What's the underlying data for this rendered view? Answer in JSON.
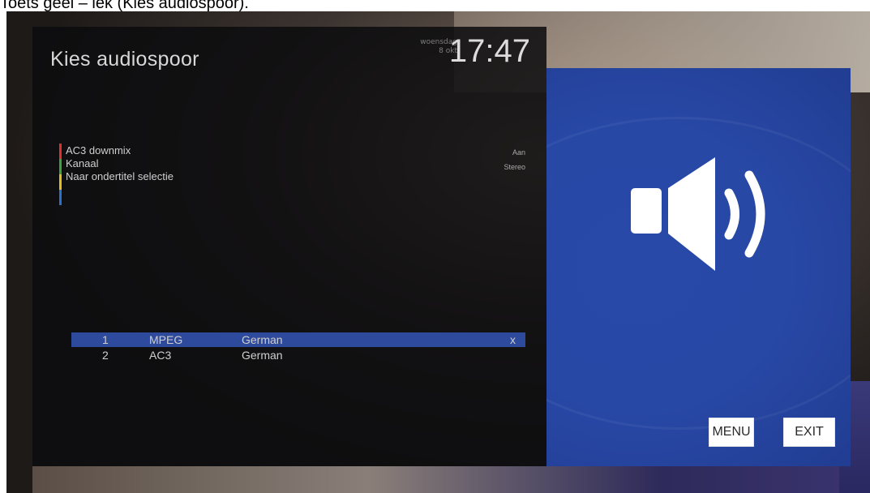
{
  "caption": "Toets geel – lek (Kies audiospoor).",
  "osd": {
    "title": "Kies audiospoor",
    "date_line1": "woensdag",
    "date_line2": "8 okt",
    "time": "17:47"
  },
  "options": [
    {
      "color": "#e0302a",
      "label": "AC3 downmix",
      "value": "Aan"
    },
    {
      "color": "#3aa53a",
      "label": "Kanaal",
      "value": "Stereo"
    },
    {
      "color": "#e0c020",
      "label": "Naar ondertitel selectie",
      "value": ""
    },
    {
      "color": "#2a70d0",
      "label": "",
      "value": ""
    }
  ],
  "tracks": [
    {
      "num": "1",
      "codec": "MPEG",
      "language": "German",
      "mark": "x",
      "selected": true
    },
    {
      "num": "2",
      "codec": "AC3",
      "language": "German",
      "mark": "",
      "selected": false
    }
  ],
  "buttons": {
    "menu": "MENU",
    "exit": "EXIT"
  },
  "icons": {
    "audio": "speaker-volume-icon"
  },
  "colors": {
    "panel_blue": "#2848a6",
    "selection": "#2e4a9c"
  }
}
